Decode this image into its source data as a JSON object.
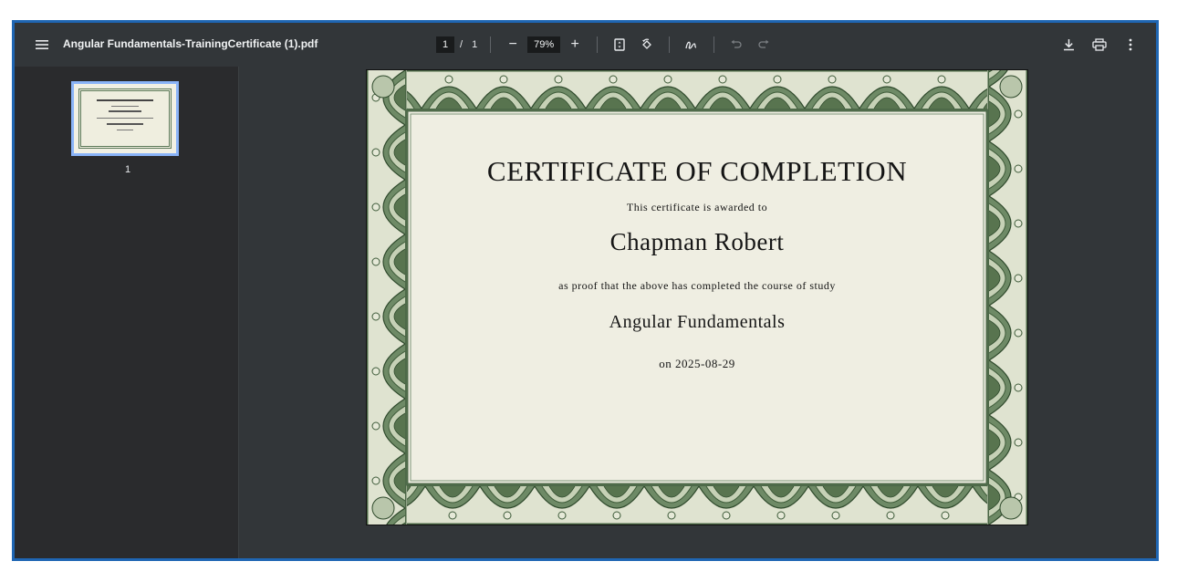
{
  "toolbar": {
    "file_name": "Angular Fundamentals-TrainingCertificate (1).pdf",
    "current_page": "1",
    "page_separator": "/",
    "total_pages": "1",
    "zoom": "79%",
    "zoom_out_symbol": "−",
    "zoom_in_symbol": "+",
    "icons": {
      "menu": "menu-icon",
      "fit": "fit-to-page-icon",
      "rotate": "rotate-icon",
      "annotate": "annotate-pen-icon",
      "undo": "undo-icon",
      "redo": "redo-icon",
      "download": "download-icon",
      "print": "print-icon",
      "more": "more-vertical-icon"
    }
  },
  "sidebar": {
    "thumbnails": [
      {
        "page_number": "1",
        "selected": true
      }
    ]
  },
  "document": {
    "title": "CERTIFICATE OF COMPLETION",
    "awarded_text": "This certificate is awarded to",
    "recipient": "Chapman Robert",
    "proof_text": "as proof that the above has completed the course of study",
    "course": "Angular Fundamentals",
    "date_text": "on 2025-08-29"
  },
  "colors": {
    "frame_border": "#1f66b3",
    "toolbar_bg": "#323639",
    "sidebar_bg": "#2a2b2d",
    "thumbnail_selected": "#8ab4f8",
    "paper": "#eeeddf",
    "certificate_border": "#5d7a5a"
  }
}
